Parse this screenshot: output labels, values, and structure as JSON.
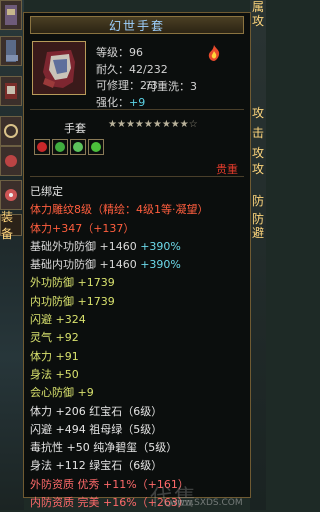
{
  "item": {
    "title": "幻世手套",
    "level": "等级：96",
    "durability": "耐久：42/232",
    "repairable": "可修理：2/3",
    "rewashable": "可重洗：3",
    "refine_label": "强化：",
    "refine_value": "+9",
    "type": "手套",
    "stars": {
      "filled": 9,
      "empty": 1
    },
    "price": "贵重",
    "gems": [
      "#c8282a",
      "#3fae3f",
      "#5cc25c",
      "#4bbf3b"
    ]
  },
  "attributes": [
    {
      "text": "已绑定",
      "color": "white"
    },
    {
      "text": "体力雕纹8级（精绘：4级1等·凝望）",
      "color": "red"
    },
    {
      "text": "体力+347（+137）",
      "color": "red"
    },
    {
      "text": "基础外功防御 +1460 ",
      "extra": "+390%",
      "color": "green"
    },
    {
      "text": "基础内功防御 +1460 ",
      "extra": "+390%",
      "color": "green"
    },
    {
      "text": "外功防御 +1739",
      "color": "yellow"
    },
    {
      "text": "内功防御 +1739",
      "color": "yellow"
    },
    {
      "text": "闪避 +324",
      "color": "yellow"
    },
    {
      "text": "灵气 +92",
      "color": "yellow"
    },
    {
      "text": "体力 +91",
      "color": "yellow"
    },
    {
      "text": "身法 +50",
      "color": "yellow"
    },
    {
      "text": "会心防御 +9",
      "color": "yellow"
    },
    {
      "text": "体力 +206 红宝石（6级）",
      "color": "white"
    },
    {
      "text": "闪避 +494 祖母绿（5级）",
      "color": "white"
    },
    {
      "text": "毒抗性 +50 纯净碧玺（5级）",
      "color": "white"
    },
    {
      "text": "身法 +112 绿宝石（6级）",
      "color": "white"
    },
    {
      "text": "外防资质  优秀 +11%（+161）",
      "color": "pink"
    },
    {
      "text": "内防资质  完美 +16%（+263）",
      "color": "pink"
    }
  ],
  "left_tab": "装备",
  "right_labels": [
    "属",
    "攻",
    "攻",
    "击",
    "攻",
    "攻",
    "防",
    "防",
    "避"
  ],
  "watermark": "代售",
  "watermark_url": "www.SXDS.COM"
}
